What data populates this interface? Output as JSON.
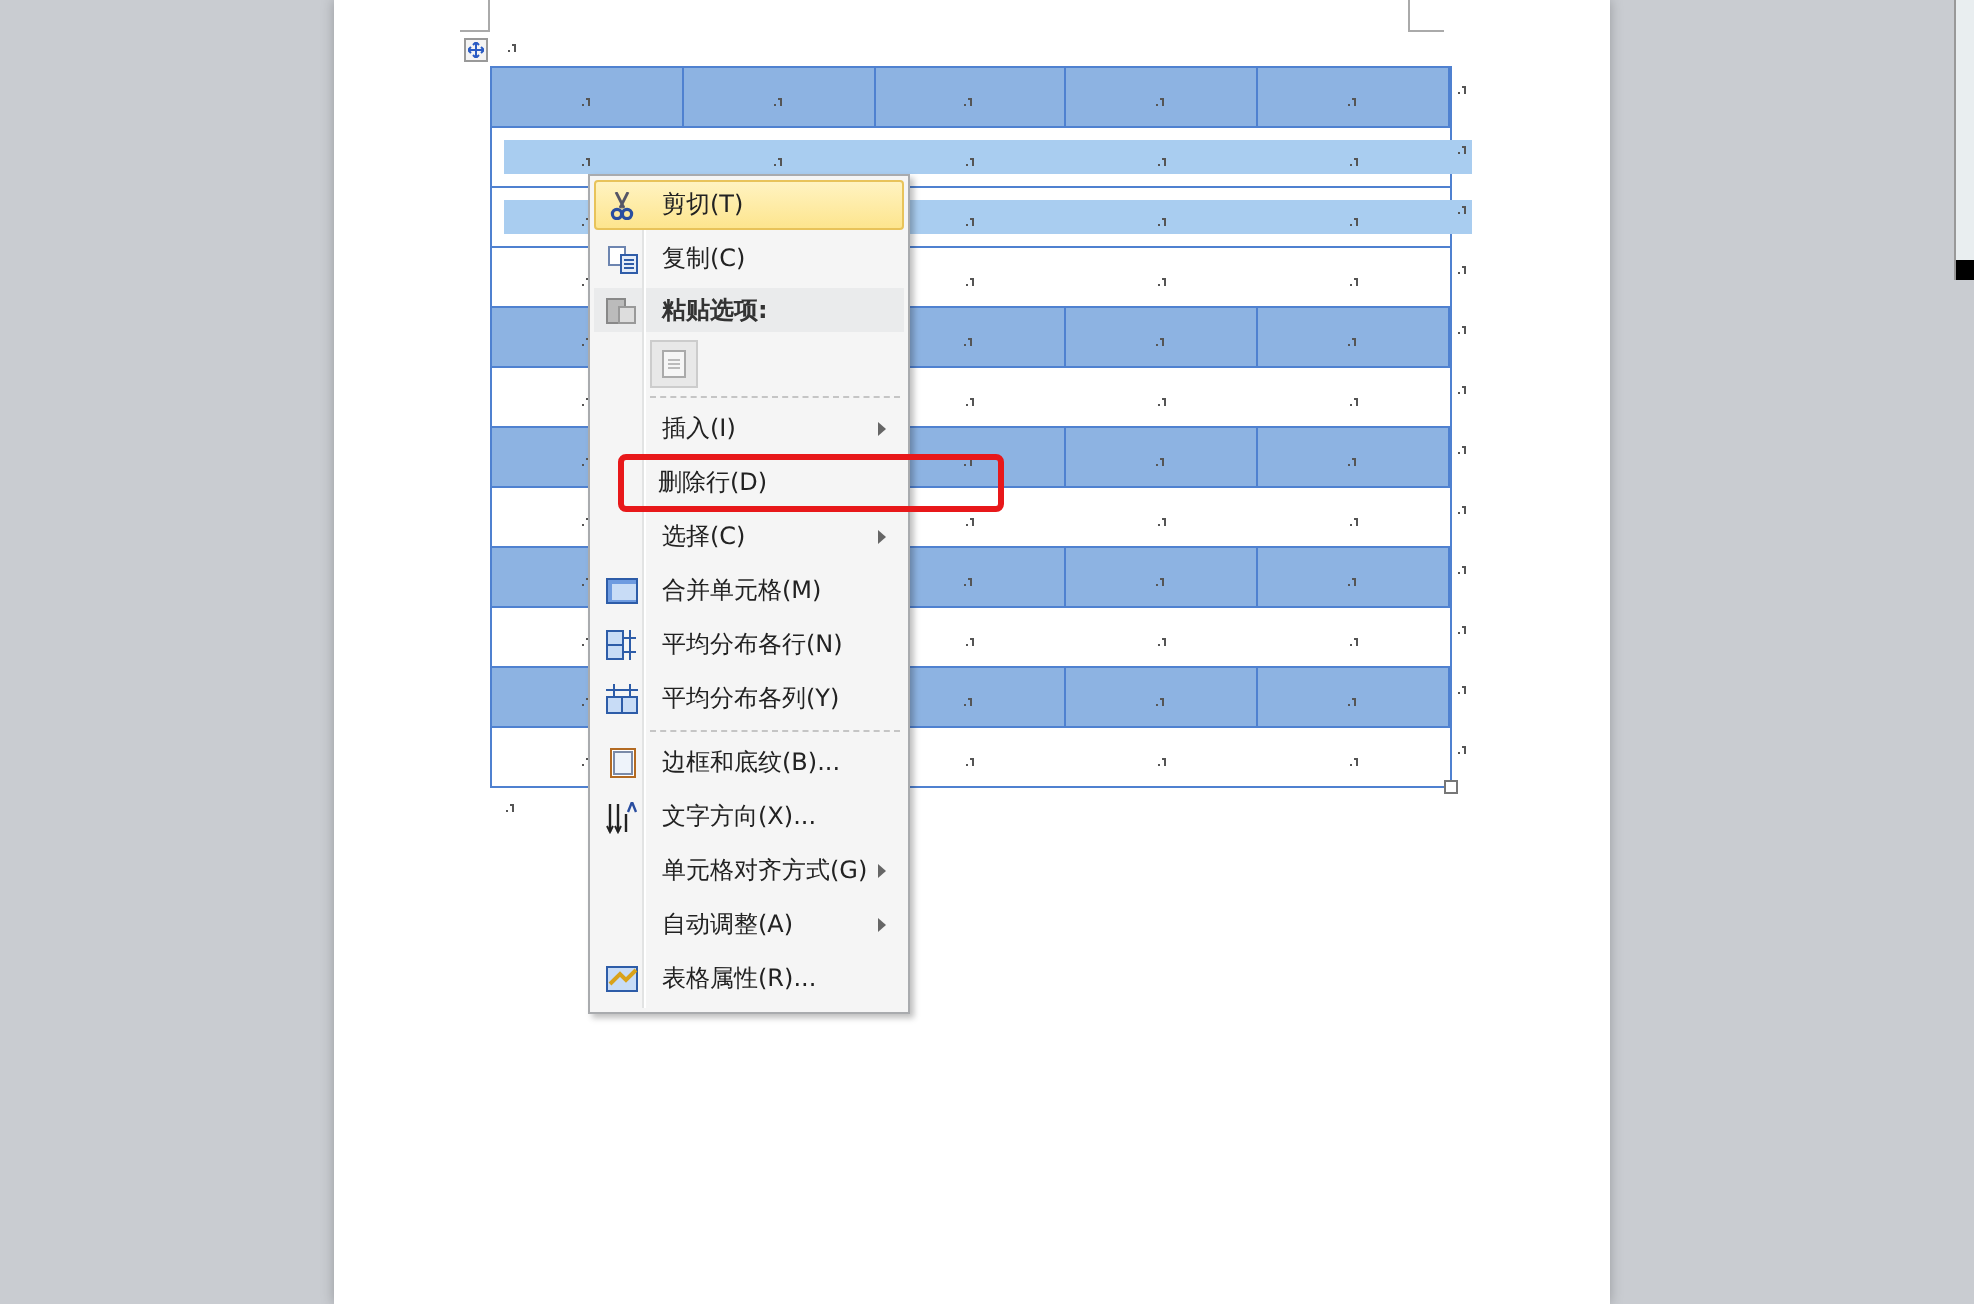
{
  "table": {
    "rows": [
      {
        "shaded": true,
        "selected": false
      },
      {
        "shaded": false,
        "selected": true
      },
      {
        "shaded": false,
        "selected": true
      },
      {
        "shaded": false,
        "selected": false
      },
      {
        "shaded": true,
        "selected": false
      },
      {
        "shaded": false,
        "selected": false
      },
      {
        "shaded": true,
        "selected": false
      },
      {
        "shaded": false,
        "selected": false
      },
      {
        "shaded": true,
        "selected": false
      },
      {
        "shaded": false,
        "selected": false
      },
      {
        "shaded": true,
        "selected": false
      },
      {
        "shaded": false,
        "selected": false
      }
    ]
  },
  "context_menu": {
    "items": [
      {
        "kind": "item",
        "label": "剪切(T)",
        "highlighted": true,
        "submenu": false,
        "annotated": false
      },
      {
        "kind": "item",
        "label": "复制(C)",
        "highlighted": false,
        "submenu": false,
        "annotated": false
      },
      {
        "kind": "header",
        "label": "粘贴选项:"
      },
      {
        "kind": "paste"
      },
      {
        "kind": "separator"
      },
      {
        "kind": "item",
        "label": "插入(I)",
        "highlighted": false,
        "submenu": true,
        "annotated": false
      },
      {
        "kind": "item",
        "label": "删除行(D)",
        "highlighted": false,
        "submenu": false,
        "annotated": true
      },
      {
        "kind": "item",
        "label": "选择(C)",
        "highlighted": false,
        "submenu": true,
        "annotated": false
      },
      {
        "kind": "item",
        "label": "合并单元格(M)",
        "highlighted": false,
        "submenu": false,
        "annotated": false
      },
      {
        "kind": "item",
        "label": "平均分布各行(N)",
        "highlighted": false,
        "submenu": false,
        "annotated": false
      },
      {
        "kind": "item",
        "label": "平均分布各列(Y)",
        "highlighted": false,
        "submenu": false,
        "annotated": false
      },
      {
        "kind": "separator"
      },
      {
        "kind": "item",
        "label": "边框和底纹(B)...",
        "highlighted": false,
        "submenu": false,
        "annotated": false
      },
      {
        "kind": "item",
        "label": "文字方向(X)...",
        "highlighted": false,
        "submenu": false,
        "annotated": false
      },
      {
        "kind": "item",
        "label": "单元格对齐方式(G)",
        "highlighted": false,
        "submenu": true,
        "annotated": false
      },
      {
        "kind": "item",
        "label": "自动调整(A)",
        "highlighted": false,
        "submenu": true,
        "annotated": false
      },
      {
        "kind": "item",
        "label": "表格属性(R)...",
        "highlighted": false,
        "submenu": false,
        "annotated": false
      }
    ]
  }
}
